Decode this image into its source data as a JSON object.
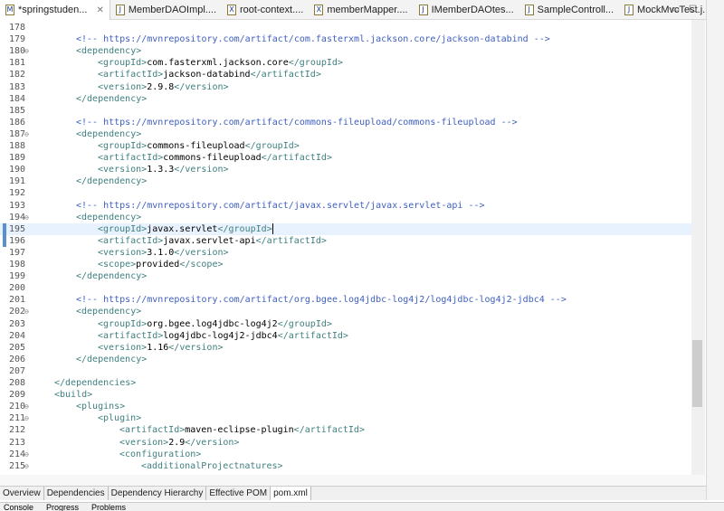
{
  "tabs": [
    {
      "label": "*springstuden...",
      "icon": "M",
      "active": true
    },
    {
      "label": "MemberDAOImpl....",
      "icon": "J"
    },
    {
      "label": "root-context....",
      "icon": "X"
    },
    {
      "label": "memberMapper....",
      "icon": "X"
    },
    {
      "label": "IMemberDAOtes...",
      "icon": "J"
    },
    {
      "label": "SampleControll...",
      "icon": "J"
    },
    {
      "label": "MockMvcTest.j...",
      "icon": "J"
    }
  ],
  "editor": {
    "current_line": "195",
    "lines": [
      {
        "n": "178",
        "i": 0,
        "p": []
      },
      {
        "n": "179",
        "i": 2,
        "p": [
          [
            "c",
            "<!-- https://mvnrepository.com/artifact/com.fasterxml.jackson.core/jackson-databind -->"
          ]
        ]
      },
      {
        "n": "180",
        "i": 2,
        "f": true,
        "p": [
          [
            "t",
            "<dependency>"
          ]
        ]
      },
      {
        "n": "181",
        "i": 3,
        "p": [
          [
            "t",
            "<groupId>"
          ],
          [
            "x",
            "com.fasterxml.jackson.core"
          ],
          [
            "t",
            "</groupId>"
          ]
        ]
      },
      {
        "n": "182",
        "i": 3,
        "p": [
          [
            "t",
            "<artifactId>"
          ],
          [
            "x",
            "jackson-databind"
          ],
          [
            "t",
            "</artifactId>"
          ]
        ]
      },
      {
        "n": "183",
        "i": 3,
        "p": [
          [
            "t",
            "<version>"
          ],
          [
            "x",
            "2.9.8"
          ],
          [
            "t",
            "</version>"
          ]
        ]
      },
      {
        "n": "184",
        "i": 2,
        "p": [
          [
            "t",
            "</dependency>"
          ]
        ]
      },
      {
        "n": "185",
        "i": 0,
        "p": []
      },
      {
        "n": "186",
        "i": 2,
        "p": [
          [
            "c",
            "<!-- https://mvnrepository.com/artifact/commons-fileupload/commons-fileupload -->"
          ]
        ]
      },
      {
        "n": "187",
        "i": 2,
        "f": true,
        "p": [
          [
            "t",
            "<dependency>"
          ]
        ]
      },
      {
        "n": "188",
        "i": 3,
        "p": [
          [
            "t",
            "<groupId>"
          ],
          [
            "x",
            "commons-fileupload"
          ],
          [
            "t",
            "</groupId>"
          ]
        ]
      },
      {
        "n": "189",
        "i": 3,
        "p": [
          [
            "t",
            "<artifactId>"
          ],
          [
            "x",
            "commons-fileupload"
          ],
          [
            "t",
            "</artifactId>"
          ]
        ]
      },
      {
        "n": "190",
        "i": 3,
        "p": [
          [
            "t",
            "<version>"
          ],
          [
            "x",
            "1.3.3"
          ],
          [
            "t",
            "</version>"
          ]
        ]
      },
      {
        "n": "191",
        "i": 2,
        "p": [
          [
            "t",
            "</dependency>"
          ]
        ]
      },
      {
        "n": "192",
        "i": 0,
        "p": []
      },
      {
        "n": "193",
        "i": 2,
        "p": [
          [
            "c",
            "<!-- https://mvnrepository.com/artifact/javax.servlet/javax.servlet-api -->"
          ]
        ]
      },
      {
        "n": "194",
        "i": 2,
        "f": true,
        "p": [
          [
            "t",
            "<dependency>"
          ]
        ]
      },
      {
        "n": "195",
        "i": 3,
        "p": [
          [
            "t",
            "<groupId>"
          ],
          [
            "x",
            "javax.servlet"
          ],
          [
            "t",
            "</groupId>"
          ]
        ]
      },
      {
        "n": "196",
        "i": 3,
        "p": [
          [
            "t",
            "<artifactId>"
          ],
          [
            "x",
            "javax.servlet-api"
          ],
          [
            "t",
            "</artifactId>"
          ]
        ]
      },
      {
        "n": "197",
        "i": 3,
        "p": [
          [
            "t",
            "<version>"
          ],
          [
            "x",
            "3.1.0"
          ],
          [
            "t",
            "</version>"
          ]
        ]
      },
      {
        "n": "198",
        "i": 3,
        "p": [
          [
            "t",
            "<scope>"
          ],
          [
            "x",
            "provided"
          ],
          [
            "t",
            "</scope>"
          ]
        ]
      },
      {
        "n": "199",
        "i": 2,
        "p": [
          [
            "t",
            "</dependency>"
          ]
        ]
      },
      {
        "n": "200",
        "i": 0,
        "p": []
      },
      {
        "n": "201",
        "i": 2,
        "p": [
          [
            "c",
            "<!-- https://mvnrepository.com/artifact/org.bgee.log4jdbc-log4j2/log4jdbc-log4j2-jdbc4 -->"
          ]
        ]
      },
      {
        "n": "202",
        "i": 2,
        "f": true,
        "p": [
          [
            "t",
            "<dependency>"
          ]
        ]
      },
      {
        "n": "203",
        "i": 3,
        "p": [
          [
            "t",
            "<groupId>"
          ],
          [
            "x",
            "org.bgee.log4jdbc-log4j2"
          ],
          [
            "t",
            "</groupId>"
          ]
        ]
      },
      {
        "n": "204",
        "i": 3,
        "p": [
          [
            "t",
            "<artifactId>"
          ],
          [
            "x",
            "log4jdbc-log4j2-jdbc4"
          ],
          [
            "t",
            "</artifactId>"
          ]
        ]
      },
      {
        "n": "205",
        "i": 3,
        "p": [
          [
            "t",
            "<version>"
          ],
          [
            "x",
            "1.16"
          ],
          [
            "t",
            "</version>"
          ]
        ]
      },
      {
        "n": "206",
        "i": 2,
        "p": [
          [
            "t",
            "</dependency>"
          ]
        ]
      },
      {
        "n": "207",
        "i": 0,
        "p": []
      },
      {
        "n": "208",
        "i": 1,
        "p": [
          [
            "t",
            "</dependencies>"
          ]
        ]
      },
      {
        "n": "209",
        "i": 1,
        "p": [
          [
            "t",
            "<build>"
          ]
        ]
      },
      {
        "n": "210",
        "i": 2,
        "f": true,
        "p": [
          [
            "t",
            "<plugins>"
          ]
        ]
      },
      {
        "n": "211",
        "i": 3,
        "f": true,
        "p": [
          [
            "t",
            "<plugin>"
          ]
        ]
      },
      {
        "n": "212",
        "i": 4,
        "p": [
          [
            "t",
            "<artifactId>"
          ],
          [
            "x",
            "maven-eclipse-plugin"
          ],
          [
            "t",
            "</artifactId>"
          ]
        ]
      },
      {
        "n": "213",
        "i": 4,
        "p": [
          [
            "t",
            "<version>"
          ],
          [
            "x",
            "2.9"
          ],
          [
            "t",
            "</version>"
          ]
        ]
      },
      {
        "n": "214",
        "i": 4,
        "f": true,
        "p": [
          [
            "t",
            "<configuration>"
          ]
        ]
      },
      {
        "n": "215",
        "i": 5,
        "f": true,
        "p": [
          [
            "t",
            "<additionalProjectnatures>"
          ]
        ]
      }
    ]
  },
  "bottom_tabs": [
    "Overview",
    "Dependencies",
    "Dependency Hierarchy",
    "Effective POM",
    "pom.xml"
  ],
  "active_bottom_tab": "pom.xml",
  "views": [
    "Console",
    "Progress",
    "Problems"
  ]
}
